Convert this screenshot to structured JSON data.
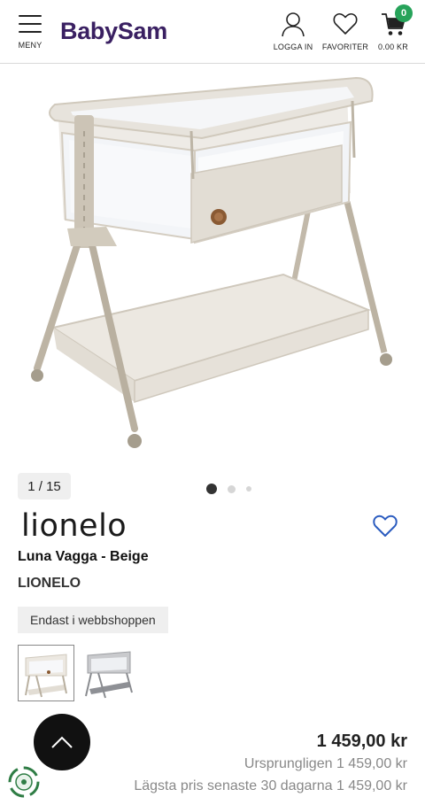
{
  "header": {
    "menu_label": "MENY",
    "logo": "BabySam",
    "login_label": "LOGGA IN",
    "favorites_label": "FAVORITER",
    "cart_total": "0.00 KR",
    "cart_count": "0"
  },
  "gallery": {
    "counter": "1 / 15",
    "dots": 3,
    "active_dot": 1
  },
  "product": {
    "brand_logo": "lionelo",
    "title": "Luna Vagga - Beige",
    "brand": "LIONELO",
    "chip": "Endast i webbshoppen",
    "variants": [
      "Beige",
      "Grey"
    ],
    "selected_variant": "Beige"
  },
  "pricing": {
    "price": "1 459,00 kr",
    "original": "Ursprungligen 1 459,00 kr",
    "lowest_30": "Lägsta pris senaste 30 dagarna 1 459,00 kr"
  },
  "icons": {
    "menu": "hamburger-icon",
    "login": "user-icon",
    "favorites": "heart-icon",
    "cart": "cart-icon",
    "scroll_top": "chevron-up-icon",
    "certification": "eco-badge-icon"
  },
  "colors": {
    "brand": "#3a2062",
    "badge": "#27a35a",
    "heart": "#2a5bbf",
    "product": "#e3ded5"
  }
}
